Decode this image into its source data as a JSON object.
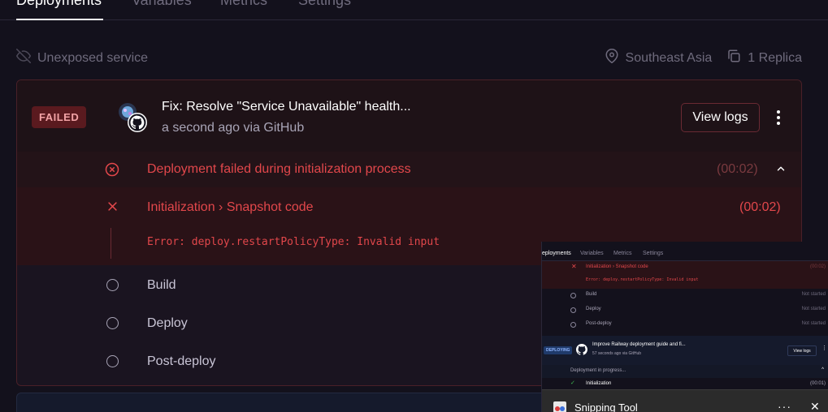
{
  "tabs": [
    {
      "label": "Deployments",
      "active": true
    },
    {
      "label": "Variables",
      "active": false
    },
    {
      "label": "Metrics",
      "active": false
    },
    {
      "label": "Settings",
      "active": false
    }
  ],
  "meta": {
    "exposure": "Unexposed service",
    "region": "Southeast Asia",
    "replicas": "1 Replica"
  },
  "deployment": {
    "status": "FAILED",
    "commit_title": "Fix: Resolve \"Service Unavailable\" health...",
    "commit_sub": "a second ago via GitHub",
    "view_logs": "View logs",
    "failure_message": "Deployment failed during initialization process",
    "failure_time": "(00:02)",
    "init_step": {
      "title": "Initialization › Snapshot code",
      "time": "(00:02)",
      "error": "Error: deploy.restartPolicyType: Invalid input"
    },
    "steps": [
      {
        "label": "Build"
      },
      {
        "label": "Deploy"
      },
      {
        "label": "Post-deploy"
      }
    ]
  },
  "snipping_overlay": {
    "tabs": [
      "eployments",
      "Variables",
      "Metrics",
      "Settings"
    ],
    "error_title": "Initialization › Snapshot code",
    "error_time": "(00:02)",
    "error_text": "Error: deploy.restartPolicyType: Invalid input",
    "steps": [
      {
        "label": "Build",
        "state": "Not started"
      },
      {
        "label": "Deploy",
        "state": "Not started"
      },
      {
        "label": "Post-deploy",
        "state": "Not started"
      }
    ],
    "card": {
      "status": "DEPLOYING",
      "title": "Improve Railway deployment guide and fi...",
      "subtitle": "57 seconds ago via GitHub",
      "view_logs": "View logs"
    },
    "progress_text": "Deployment in progress...",
    "init_label": "Initialization",
    "init_time": "(00:01)",
    "app_name": "Snipping Tool"
  },
  "colors": {
    "background": "#13111c",
    "failed_red": "#e2474b",
    "failed_badge_bg": "#5a1a1f"
  }
}
